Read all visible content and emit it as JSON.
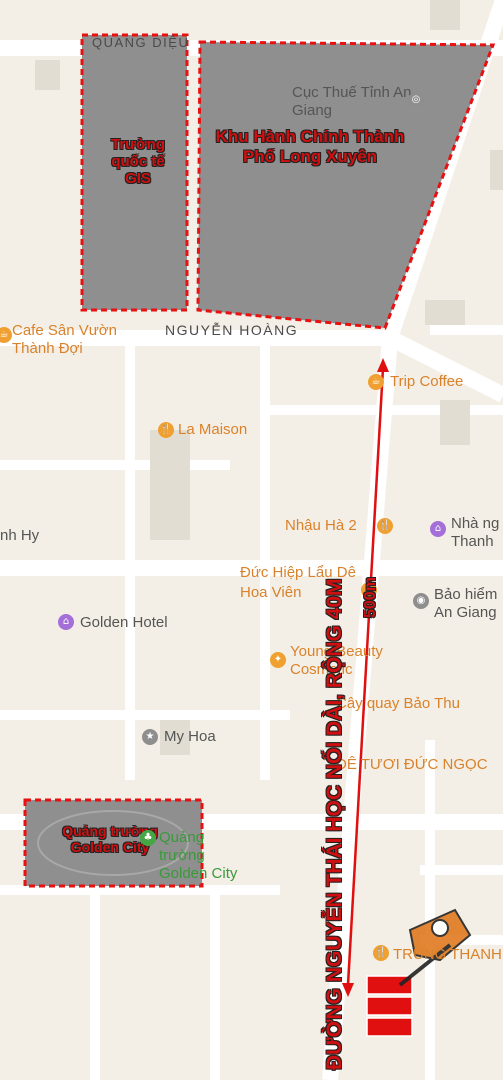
{
  "streets": {
    "quang_dieu": "QUANG DIỆU",
    "nguyen_hoang": "NGUYỄN HOÀNG"
  },
  "zones": {
    "gis": "Trường quốc tế GIS",
    "admin": "Khu Hành Chính Thành Phố Long Xuyên",
    "square": "Quảng trường Golden City"
  },
  "pois": {
    "tax_office": "Cục Thuế Tỉnh An Giang",
    "cafe_san_vuon": "Cafe Sân Vườn Thành Đợi",
    "trip_coffee": "Trip Coffee",
    "la_maison": "La Maison",
    "nhau_ha": "Nhậu Hà 2",
    "nha_nghi": "Nhà ng Thanh",
    "duc_hiep": "Đức Hiệp Lẩu Dê Hoa Viên",
    "bao_hiem": "Bảo hiểm An Giang",
    "golden_hotel": "Golden Hotel",
    "young_beauty": "Young Beauty Cosmetic",
    "cay_quay": "Cây quay Bảo Thu",
    "my_hoa": "My Hoa",
    "de_tuoi": "DÊ TƯƠI ĐỨC NGỌC",
    "square_label": "Quảng trường Golden City",
    "thanh_hy": "nh Hy",
    "trung_thanh": "TRUNG THANH"
  },
  "annotations": {
    "road_name": "ĐƯỜNG NGUYỄN THÁI HỌC NỐI DÀI, RỘNG 40M",
    "distance": "500m"
  },
  "colors": {
    "background": "#f4efe6",
    "zone_fill": "#8f8f8f",
    "highlight_red": "#d01010",
    "poi_orange": "#d9822b",
    "poi_purple": "#a46fd8",
    "poi_green": "#45a845"
  }
}
